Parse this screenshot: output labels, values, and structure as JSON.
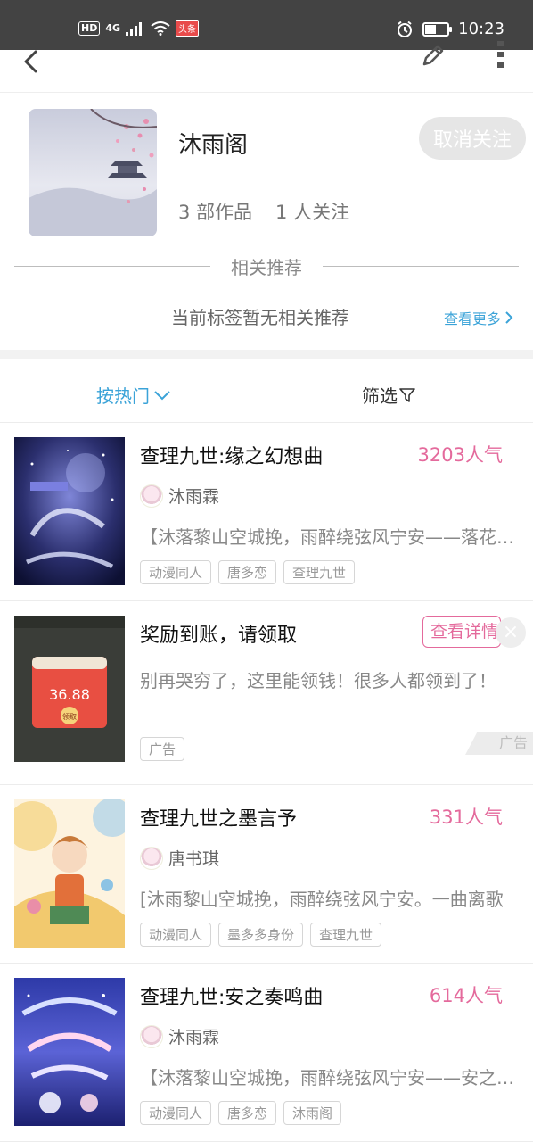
{
  "status_bar": {
    "network_badge": "HD",
    "network_type": "4G",
    "app_badge": "头条",
    "time": "10:23"
  },
  "nav": {
    "back_icon": "back-arrow-icon",
    "edit_icon": "pencil-icon",
    "more_icon": "more-vertical-icon"
  },
  "profile": {
    "name": "沐雨阁",
    "works": "3 部作品",
    "followers": "1 人关注",
    "unfollow_label": "取消关注"
  },
  "related": {
    "title": "相关推荐",
    "empty_text": "当前标签暂无相关推荐",
    "see_more": "查看更多"
  },
  "filter": {
    "sort_label": "按热门",
    "filter_label": "筛选"
  },
  "items": [
    {
      "title": "查理九世:缘之幻想曲",
      "popularity": "3203人气",
      "author": "沐雨霖",
      "desc": "【沐落黎山空城挽，雨醉绕弦风宁安——落花有意，流水无情",
      "tags": [
        "动漫同人",
        "唐多恋",
        "查理九世"
      ]
    },
    {
      "title": "查理九世之墨言予",
      "popularity": "331人气",
      "author": "唐书琪",
      "desc": "[沐雨黎山空城挽，雨醉绕弦风宁安。一曲离歌",
      "tags": [
        "动漫同人",
        "墨多多身份",
        "查理九世"
      ]
    },
    {
      "title": "查理九世:安之奏鸣曲",
      "popularity": "614人气",
      "author": "沐雨霖",
      "desc": "【沐落黎山空城挽，雨醉绕弦风宁安——安之奏鸣",
      "tags": [
        "动漫同人",
        "唐多恋",
        "沐雨阁"
      ]
    }
  ],
  "ad": {
    "title": "奖励到账，请领取",
    "detail_label": "查看详情",
    "desc": "别再哭穷了，这里能领钱！很多人都领到了！",
    "tag": "广告",
    "corner_label": "广告",
    "image_amount": "36.88",
    "image_button": "领取"
  }
}
